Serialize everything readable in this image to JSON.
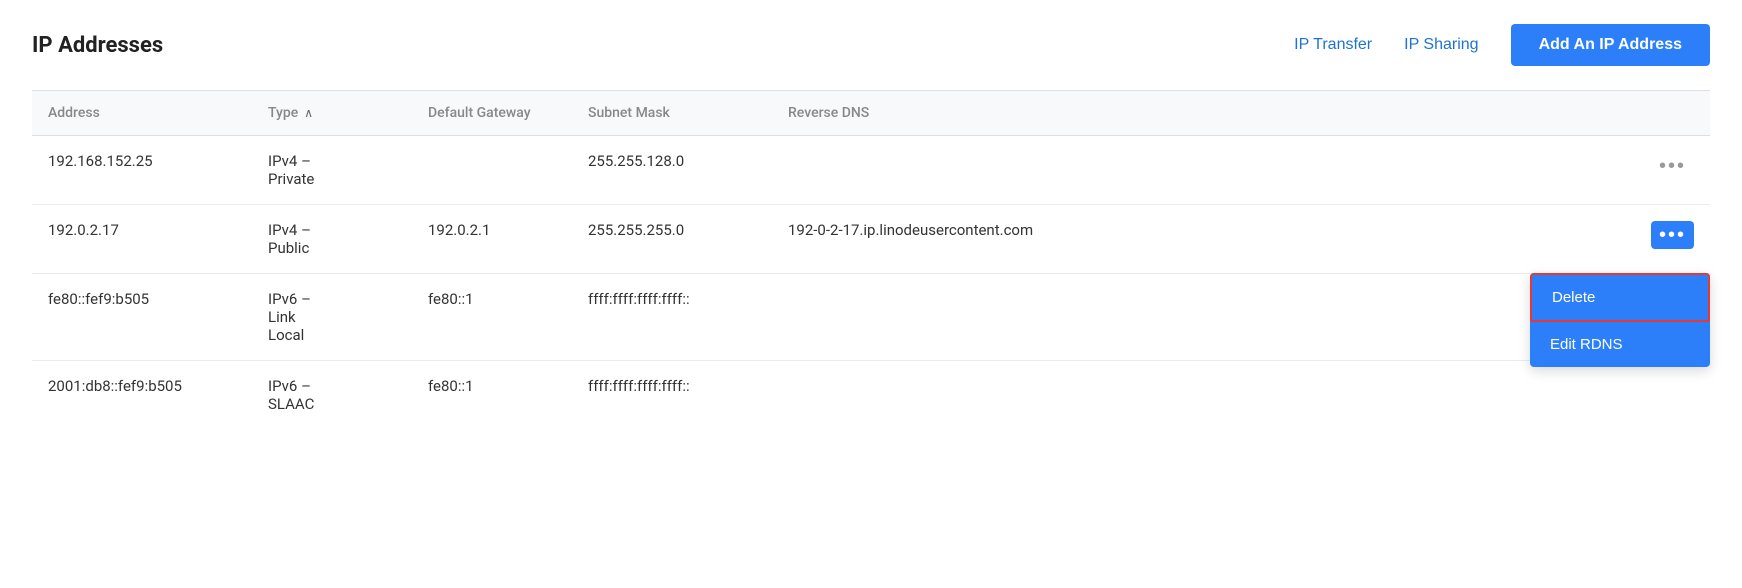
{
  "header": {
    "title": "IP Addresses",
    "ip_transfer_label": "IP Transfer",
    "ip_sharing_label": "IP Sharing",
    "add_button_label": "Add An IP Address"
  },
  "table": {
    "columns": [
      {
        "key": "address",
        "label": "Address"
      },
      {
        "key": "type",
        "label": "Type",
        "sortable": true
      },
      {
        "key": "gateway",
        "label": "Default Gateway"
      },
      {
        "key": "subnet",
        "label": "Subnet Mask"
      },
      {
        "key": "rdns",
        "label": "Reverse DNS"
      }
    ],
    "rows": [
      {
        "address": "192.168.152.25",
        "type": "IPv4 –\nPrivate",
        "gateway": "",
        "subnet": "255.255.128.0",
        "rdns": "",
        "has_menu": false,
        "menu_open": false
      },
      {
        "address": "192.0.2.17",
        "type": "IPv4 –\nPublic",
        "gateway": "192.0.2.1",
        "subnet": "255.255.255.0",
        "rdns": "192-0-2-17.ip.linodeusercontent.com",
        "has_menu": true,
        "menu_open": true
      },
      {
        "address": "fe80::fef9:b505",
        "type": "IPv6 –\nLink\nLocal",
        "gateway": "fe80::1",
        "subnet": "ffff:ffff:ffff:ffff::",
        "rdns": "",
        "has_menu": false,
        "menu_open": false
      },
      {
        "address": "2001:db8::fef9:b505",
        "type": "IPv6 –\nSLAAC",
        "gateway": "fe80::1",
        "subnet": "ffff:ffff:ffff:ffff::",
        "rdns": "",
        "has_menu": false,
        "menu_open": false
      }
    ],
    "dropdown": {
      "delete_label": "Delete",
      "edit_rdns_label": "Edit RDNS"
    }
  }
}
